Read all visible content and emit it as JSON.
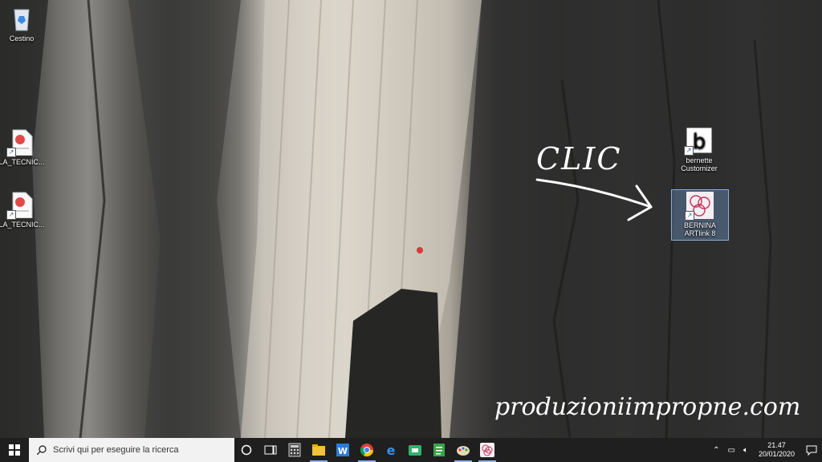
{
  "desktop": {
    "icons": [
      {
        "label": "Cestino",
        "icon": "recycle-bin-icon"
      },
      {
        "label": "LA_TECNIC...",
        "icon": "pdf-file-icon"
      },
      {
        "label": "LA_TECNIC...",
        "icon": "pdf-file-icon"
      },
      {
        "label": "bernette Customizer",
        "icon": "bernette-app-icon"
      },
      {
        "label": "BERNINA ARTlink 8",
        "icon": "bernina-artlink-icon"
      }
    ],
    "annotation_text": "CLIC",
    "watermark": "produzioniimpropne.com"
  },
  "taskbar": {
    "search_placeholder": "Scrivi qui per eseguire la ricerca",
    "apps": [
      "task-view-icon",
      "calculator-icon",
      "file-explorer-icon",
      "word-icon",
      "chrome-icon",
      "edge-icon",
      "store-icon",
      "notes-icon",
      "paint-icon",
      "bernina-artlink-icon"
    ],
    "clock_time": "21.47",
    "clock_date": "20/01/2020",
    "accent": "#8ab4f8"
  }
}
